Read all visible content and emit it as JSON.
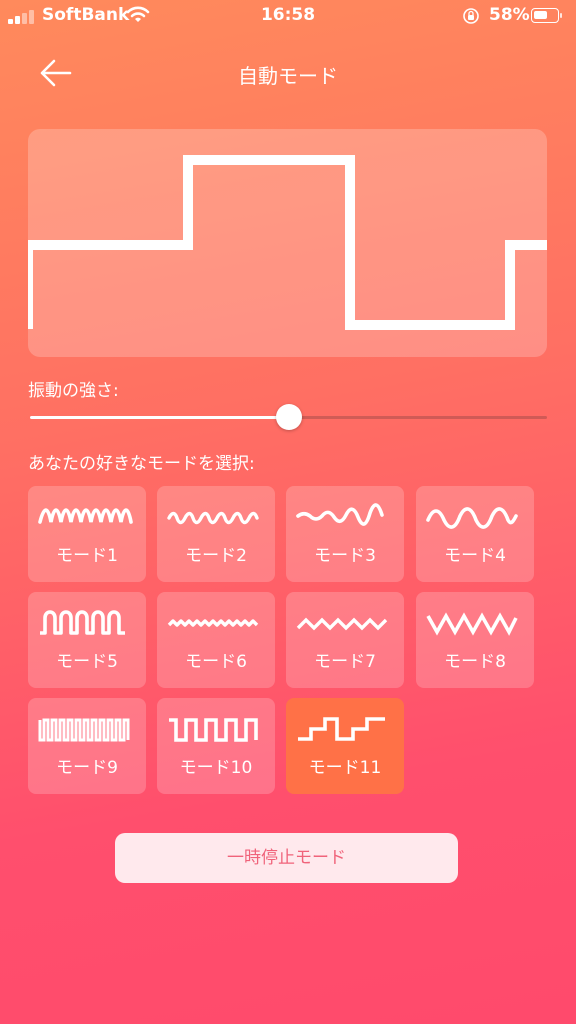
{
  "status_bar": {
    "carrier": "SoftBank",
    "time": "16:58",
    "battery_text": "58%",
    "battery_level": 0.58,
    "icons": [
      "signal-icon",
      "wifi-icon",
      "orientation-lock-icon",
      "battery-icon"
    ]
  },
  "header": {
    "title": "自動モード",
    "back_icon": "arrow-left-icon"
  },
  "waveform": {
    "pattern": "stepped-square",
    "levels": [
      0.5,
      0.5,
      1.0,
      1.0,
      0.1,
      0.1,
      0.5
    ],
    "stroke_color": "#ffffff"
  },
  "intensity": {
    "label": "振動の強さ:",
    "value": 0.5
  },
  "modes": {
    "label": "あなたの好きなモードを選択:",
    "selected_index": 10,
    "items": [
      {
        "label": "モード1",
        "icon": "wave-mode-1-icon"
      },
      {
        "label": "モード2",
        "icon": "wave-mode-2-icon"
      },
      {
        "label": "モード3",
        "icon": "wave-mode-3-icon"
      },
      {
        "label": "モード4",
        "icon": "wave-mode-4-icon"
      },
      {
        "label": "モード5",
        "icon": "wave-mode-5-icon"
      },
      {
        "label": "モード6",
        "icon": "wave-mode-6-icon"
      },
      {
        "label": "モード7",
        "icon": "wave-mode-7-icon"
      },
      {
        "label": "モード8",
        "icon": "wave-mode-8-icon"
      },
      {
        "label": "モード9",
        "icon": "wave-mode-9-icon"
      },
      {
        "label": "モード10",
        "icon": "wave-mode-10-icon"
      },
      {
        "label": "モード11",
        "icon": "wave-mode-11-icon"
      }
    ]
  },
  "pause_button": {
    "label": "一時停止モード"
  },
  "colors": {
    "background_top": "#ff8a5c",
    "background_bottom": "#ff4a6c",
    "selected_tile": "#ff7147",
    "pause_text": "#f0637a"
  }
}
